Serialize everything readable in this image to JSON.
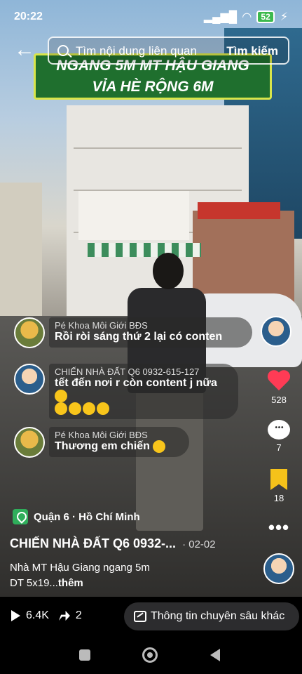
{
  "status_bar": {
    "time": "20:22",
    "battery": "52"
  },
  "search": {
    "placeholder": "Tìm nội dung liên quan",
    "button": "Tìm kiếm"
  },
  "video_banner": {
    "line1": "NGANG 5M MT HẬU GIANG",
    "line2": "VỈA HÈ RỘNG 6M"
  },
  "comments": [
    {
      "name": "Pé Khoa Môi Giới BĐS",
      "text": "Rồi ròi sáng thứ 2 lại có conten"
    },
    {
      "name": "CHIẾN NHÀ ĐẤT Q6 0932-615-127",
      "text": "tết đến nơi r còn content j nữa"
    },
    {
      "name": "Pé Khoa Môi Giới BĐS",
      "text": "Thương em chiến"
    }
  ],
  "rail": {
    "likes": "528",
    "comments": "7",
    "saves": "18"
  },
  "post": {
    "location": "Quận 6 · Hồ Chí Minh",
    "author": "CHIẾN NHÀ ĐẤT Q6 0932-...",
    "date": "· 02-02",
    "desc_line1": "Nhà MT Hậu Giang ngang 5m",
    "desc_line2": "DT 5x19...",
    "more": "thêm"
  },
  "bottom": {
    "views": "6.4K",
    "shares": "2",
    "deep_button": "Thông tin chuyên sâu khác"
  }
}
